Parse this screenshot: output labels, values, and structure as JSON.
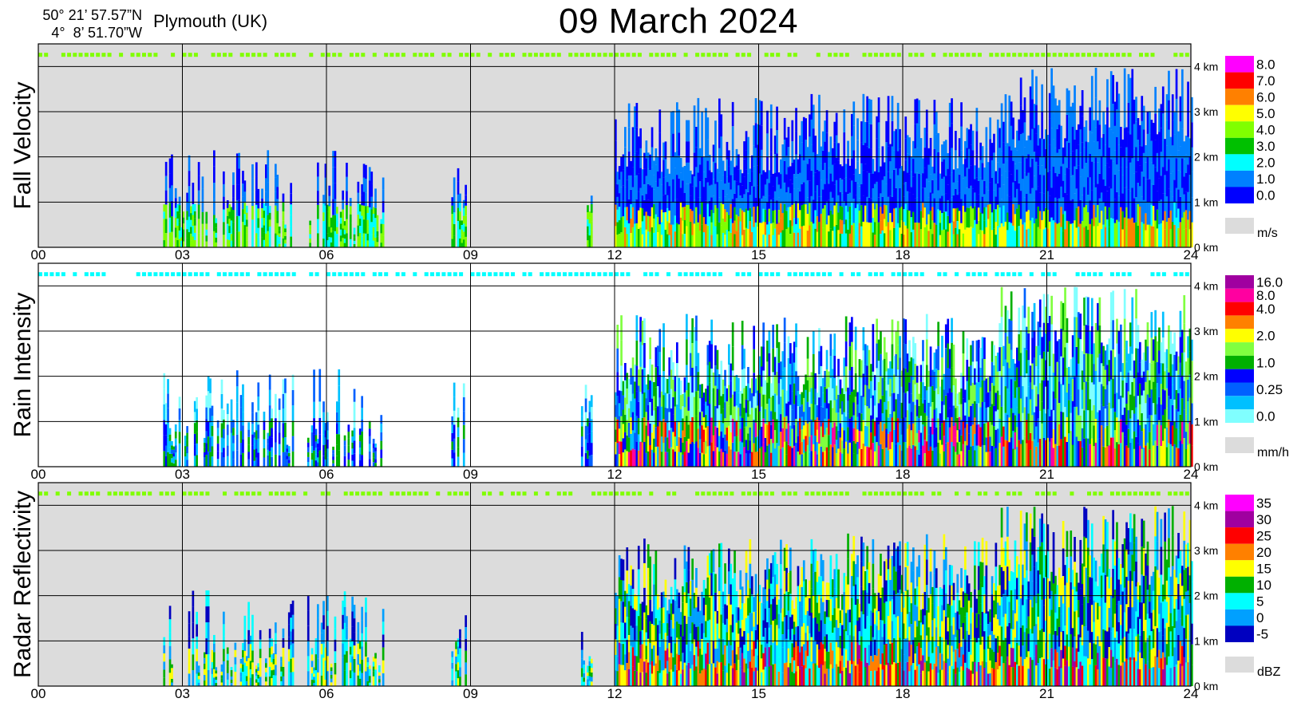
{
  "header": {
    "lat": "50° 21’ 57.57”N",
    "lon": "4°  8’ 51.70”W",
    "location": "Plymouth (UK)",
    "date": "09 March 2024"
  },
  "chart_data": [
    {
      "type": "heatmap",
      "title": "Fall Velocity",
      "x_ticks": [
        "00",
        "03",
        "06",
        "09",
        "12",
        "15",
        "18",
        "21",
        "24"
      ],
      "xlim": [
        0,
        24
      ],
      "y_ticks": [
        "0 km",
        "1 km",
        "2 km",
        "3 km",
        "4 km"
      ],
      "ylim": [
        0,
        4.5
      ],
      "unit": "m/s",
      "background": "#dcdcdc",
      "legend": [
        {
          "label": "8.0",
          "color": "#ff00ff"
        },
        {
          "label": "7.0",
          "color": "#ff0000"
        },
        {
          "label": "6.0",
          "color": "#ff8000"
        },
        {
          "label": "5.0",
          "color": "#ffff00"
        },
        {
          "label": "4.0",
          "color": "#80ff00"
        },
        {
          "label": "3.0",
          "color": "#00c000"
        },
        {
          "label": "2.0",
          "color": "#00ffff"
        },
        {
          "label": "1.0",
          "color": "#0080ff"
        },
        {
          "label": "0.0",
          "color": "#0000ff"
        }
      ],
      "nodata_color": "#dcdcdc"
    },
    {
      "type": "heatmap",
      "title": "Rain Intensity",
      "x_ticks": [
        "00",
        "03",
        "06",
        "09",
        "12",
        "15",
        "18",
        "21",
        "24"
      ],
      "xlim": [
        0,
        24
      ],
      "y_ticks": [
        "0 km",
        "1 km",
        "2 km",
        "3 km",
        "4 km"
      ],
      "ylim": [
        0,
        4.5
      ],
      "unit": "mm/h",
      "background": "#ffffff",
      "legend": [
        {
          "label": "16.0",
          "color": "#a000a0"
        },
        {
          "label": "8.0",
          "color": "#ff00a0"
        },
        {
          "label": "4.0",
          "color": "#ff0000"
        },
        {
          "label": "",
          "color": "#ff8000"
        },
        {
          "label": "2.0",
          "color": "#ffff00"
        },
        {
          "label": "",
          "color": "#80ff40"
        },
        {
          "label": "1.0",
          "color": "#00b000"
        },
        {
          "label": "",
          "color": "#0000ff"
        },
        {
          "label": "0.25",
          "color": "#0060ff"
        },
        {
          "label": "",
          "color": "#00c0ff"
        },
        {
          "label": "0.0",
          "color": "#80ffff"
        }
      ],
      "nodata_color": "#dcdcdc"
    },
    {
      "type": "heatmap",
      "title": "Radar Reflectivity",
      "x_ticks": [
        "00",
        "03",
        "06",
        "09",
        "12",
        "15",
        "18",
        "21",
        "24"
      ],
      "xlim": [
        0,
        24
      ],
      "y_ticks": [
        "0 km",
        "1 km",
        "2 km",
        "3 km",
        "4 km"
      ],
      "ylim": [
        0,
        4.5
      ],
      "unit": "dBZ",
      "background": "#dcdcdc",
      "legend": [
        {
          "label": "35",
          "color": "#ff00ff"
        },
        {
          "label": "30",
          "color": "#a000a0"
        },
        {
          "label": "25",
          "color": "#ff0000"
        },
        {
          "label": "20",
          "color": "#ff8000"
        },
        {
          "label": "15",
          "color": "#ffff00"
        },
        {
          "label": "10",
          "color": "#00b000"
        },
        {
          "label": "5",
          "color": "#00ffff"
        },
        {
          "label": "0",
          "color": "#00a0ff"
        },
        {
          "label": "-5",
          "color": "#0000c0"
        }
      ],
      "nodata_color": "#dcdcdc"
    }
  ],
  "approx_precip_periods_hours": [
    {
      "start": 2.6,
      "end": 5.3
    },
    {
      "start": 5.6,
      "end": 7.2
    },
    {
      "start": 8.6,
      "end": 8.9
    },
    {
      "start": 11.3,
      "end": 11.5
    },
    {
      "start": 12.0,
      "end": 24.0
    }
  ]
}
